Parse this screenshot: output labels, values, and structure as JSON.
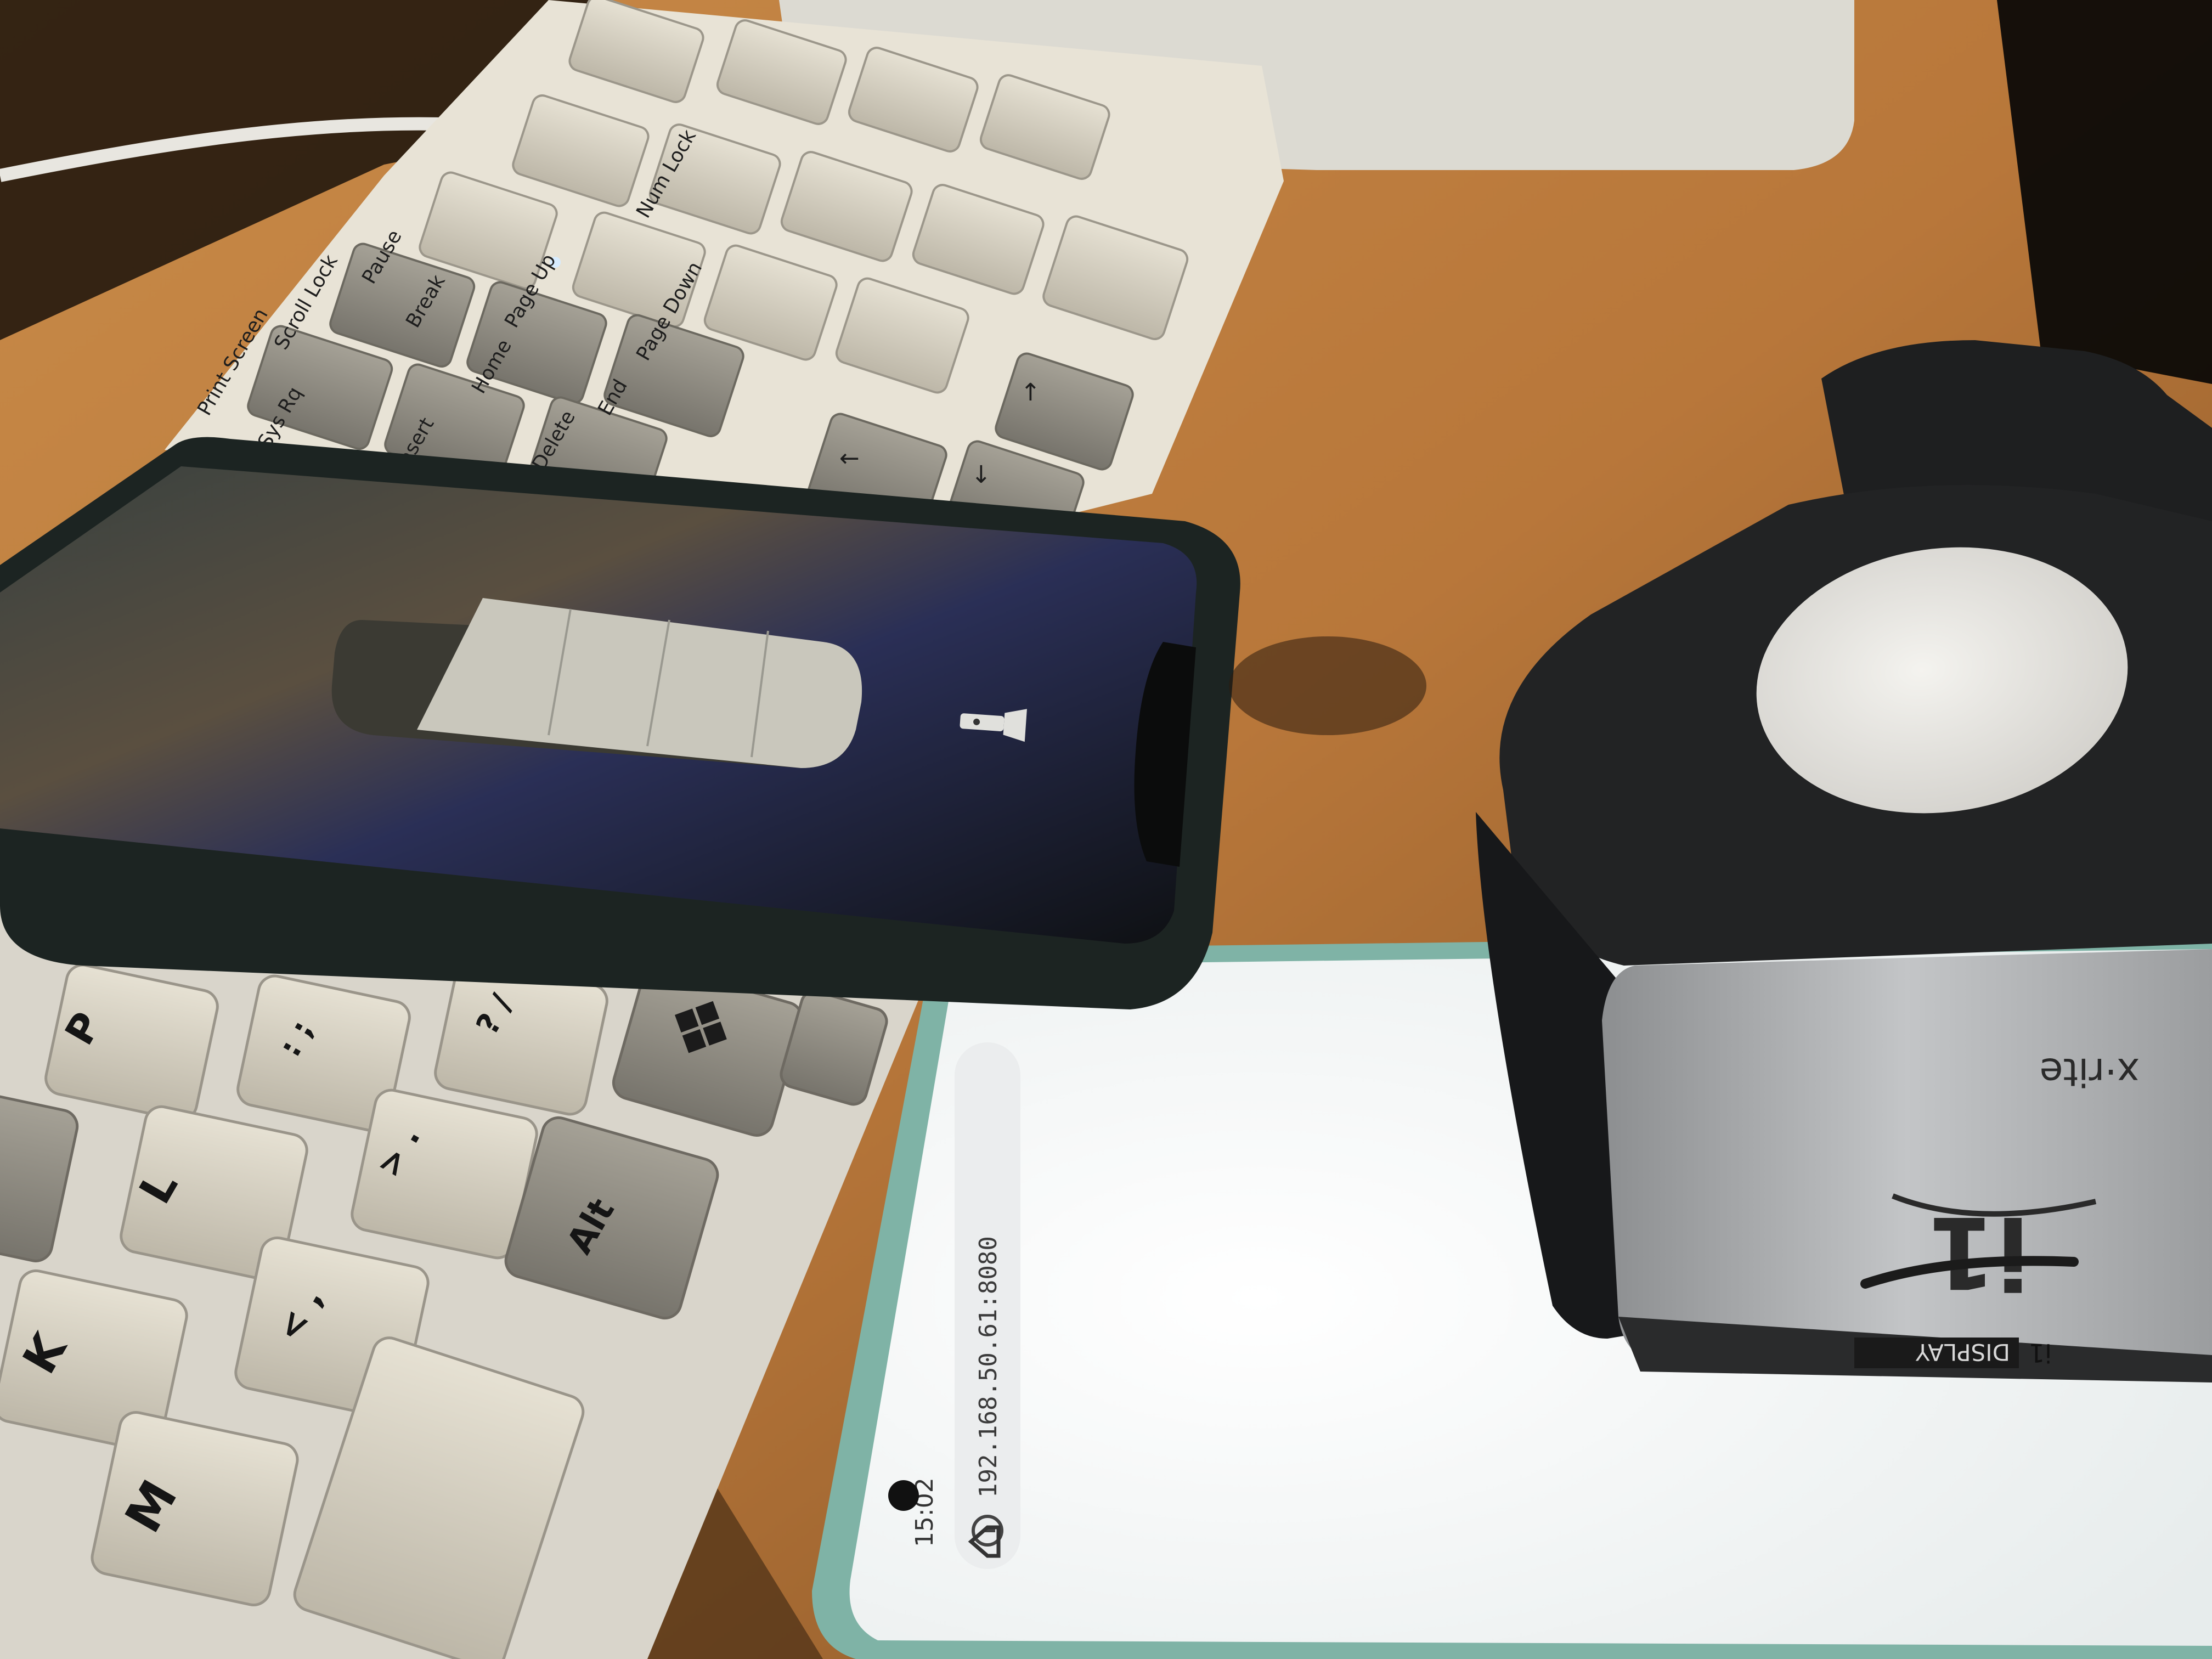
{
  "phone_screen": {
    "status_time": "15:02",
    "address_bar": {
      "url": "192.168.50.61:8080"
    },
    "icons": [
      "info-icon",
      "home-icon",
      "camera-icon"
    ]
  },
  "colorimeter": {
    "brand_label": "x·rite",
    "logo_text": "i1",
    "model_label_prefix": "i1",
    "model_label_badge": "DISPLAY"
  },
  "iphone_screen": {
    "icons": [
      "flashlight-icon"
    ]
  },
  "keyboard": {
    "keys": {
      "p": "P",
      "l": "L",
      "k": "K",
      "m": "M",
      "alt": "Alt",
      "question": "? /",
      "colon": ": ;",
      "greater": "> .",
      "less": "< ,",
      "home": "Home",
      "end": "End",
      "insert": "Insert",
      "delete": "Delete",
      "page_up": "Page Up",
      "page_down": "Page Down",
      "print": "Print Screen",
      "sysrq": "Sys Rq",
      "scroll": "Scroll Lock",
      "pause": "Pause",
      "break": "Break",
      "num": "Num Lock",
      "arrow_up": "↑",
      "arrow_left": "←",
      "arrow_down": "↓"
    }
  },
  "colors": {
    "desk": "#b97a3c",
    "keycap": "#d8d2c2",
    "keycap_dark": "#8c887f",
    "phone_screen": "#f3f4f4",
    "iphone_body": "#1c2422",
    "colorimeter_body": "#202122",
    "colorimeter_silver": "#a6a8aa"
  }
}
